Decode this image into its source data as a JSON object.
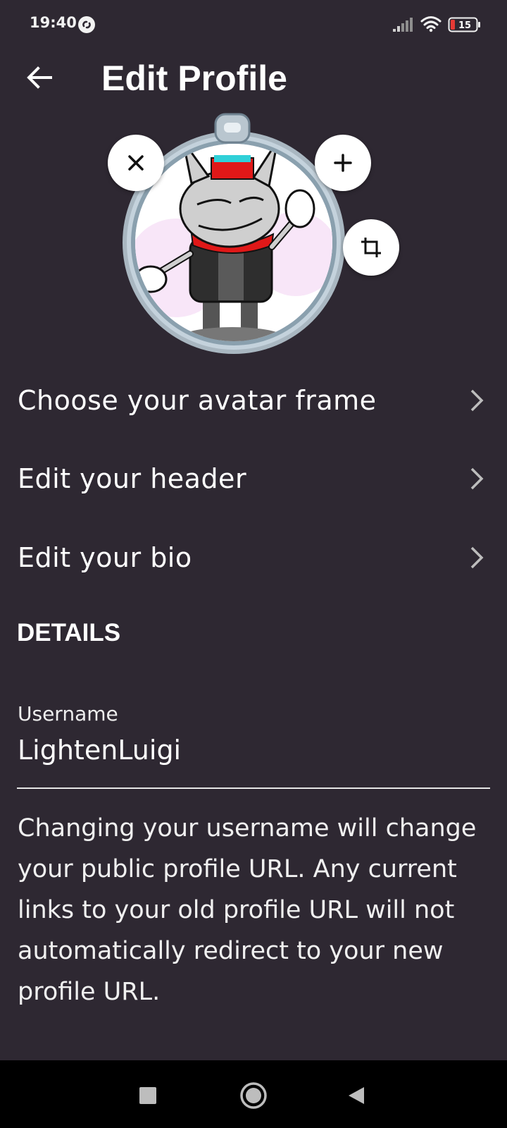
{
  "status_bar": {
    "time": "19:40",
    "battery_level": "15",
    "icons": [
      "app-notification-icon",
      "signal-icon",
      "wifi-icon",
      "battery-icon"
    ]
  },
  "header": {
    "title": "Edit Profile",
    "back_icon": "arrow-left-icon"
  },
  "avatar": {
    "actions": [
      "remove-avatar",
      "add-avatar",
      "crop-avatar"
    ]
  },
  "menu": {
    "items": [
      {
        "label": "Choose your avatar frame"
      },
      {
        "label": "Edit your header"
      },
      {
        "label": "Edit your bio"
      }
    ]
  },
  "details": {
    "section_title": "DETAILS",
    "username_label": "Username",
    "username_value": "LightenLuigi",
    "help_text": "Changing your username will change your public profile URL. Any current links to your old profile URL will not automatically redirect to your new profile URL."
  },
  "colors": {
    "background": "#2e2832",
    "nav_background": "#000000",
    "text": "#ffffff"
  }
}
